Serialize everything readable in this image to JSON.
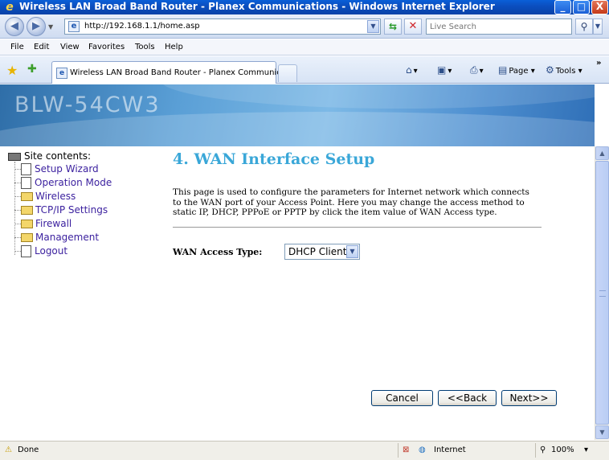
{
  "window": {
    "title": "Wireless LAN Broad Band Router - Planex Communications - Windows Internet Explorer",
    "minimize": "_",
    "maximize": "□",
    "close": "X"
  },
  "toolbar": {
    "back": "◀",
    "forward": "▶",
    "address": "http://192.168.1.1/home.asp",
    "search_placeholder": "Live Search"
  },
  "menu": [
    "File",
    "Edit",
    "View",
    "Favorites",
    "Tools",
    "Help"
  ],
  "tabs": {
    "active_label": "Wireless LAN Broad Band Router - Planex Communicat...",
    "page_label": "Page",
    "tools_label": "Tools"
  },
  "banner": {
    "brand": "BLW-54CW3"
  },
  "site_tree": {
    "root": "Site contents:",
    "items": [
      {
        "label": "Setup Wizard",
        "icon": "document-icon"
      },
      {
        "label": "Operation Mode",
        "icon": "document-icon"
      },
      {
        "label": "Wireless",
        "icon": "folder-icon"
      },
      {
        "label": "TCP/IP Settings",
        "icon": "folder-icon"
      },
      {
        "label": "Firewall",
        "icon": "folder-icon"
      },
      {
        "label": "Management",
        "icon": "folder-icon"
      },
      {
        "label": "Logout",
        "icon": "document-icon"
      }
    ]
  },
  "main": {
    "title": "4. WAN Interface Setup",
    "description": "This page is used to configure the parameters for Internet network which connects to the WAN port of your Access Point. Here you may change the access method to static IP, DHCP, PPPoE or PPTP by click the item value of WAN Access type.",
    "wan_access_label": "WAN Access Type:",
    "wan_access_value": "DHCP Client",
    "cancel": "Cancel",
    "back": "<<Back",
    "next": "Next>>"
  },
  "status": {
    "done": "Done",
    "zone": "Internet",
    "zoom": "100%"
  }
}
